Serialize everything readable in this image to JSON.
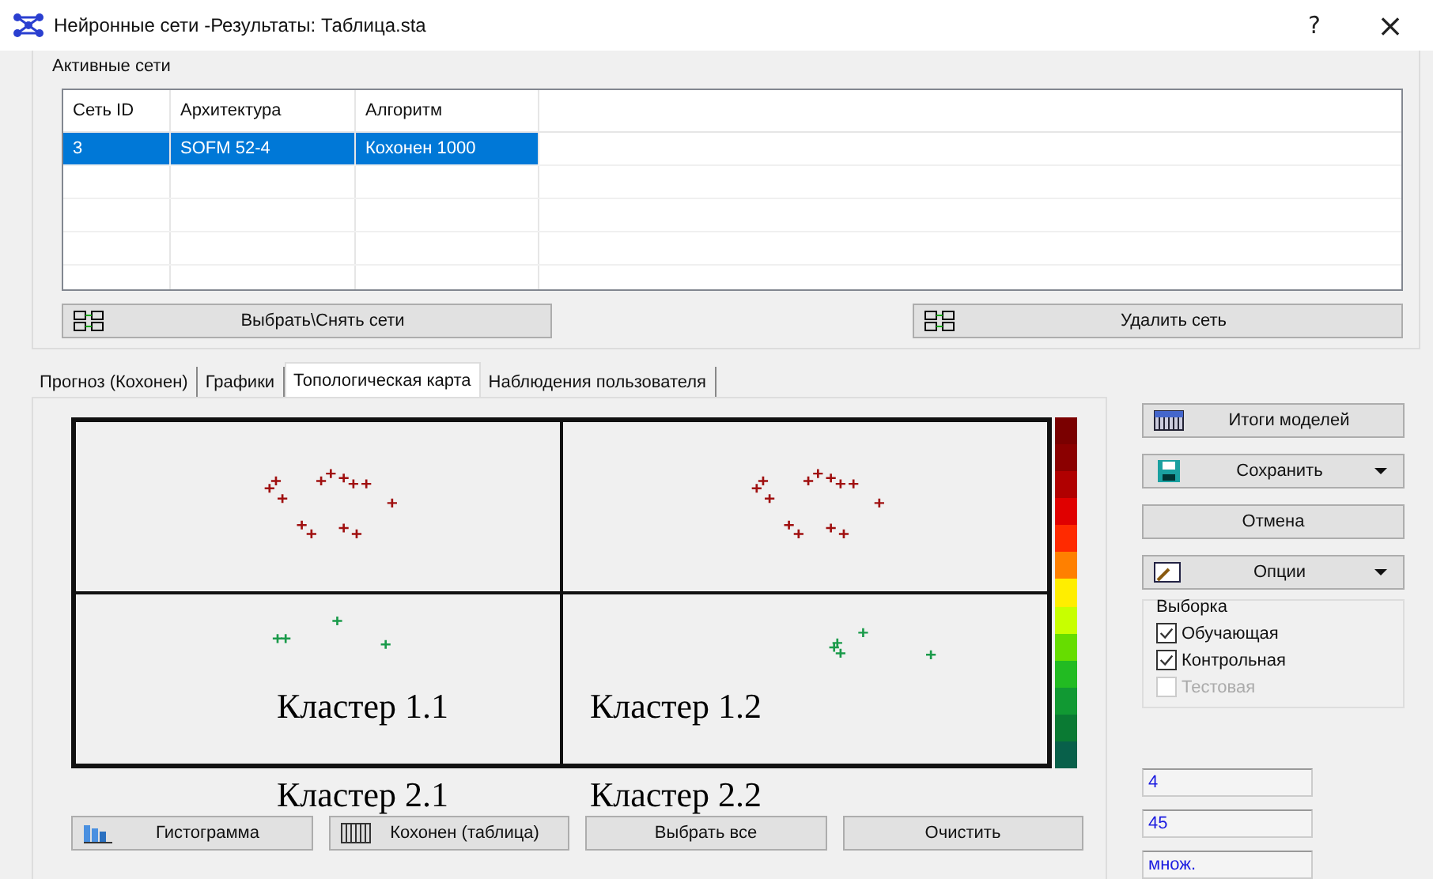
{
  "window": {
    "title": "Нейронные сети -Результаты: Таблица.sta",
    "help": "?",
    "close": "×"
  },
  "active_nets": {
    "title": "Активные сети",
    "columns": [
      "Сеть ID",
      "Архитектура",
      "Алгоритм"
    ],
    "rows": [
      {
        "cells": [
          "3",
          "SOFM 52-4",
          "Кохонен 1000"
        ],
        "selected": true
      }
    ],
    "buttons": [
      {
        "label": "Выбрать\\Снять сети"
      },
      {
        "label": "Удалить сеть"
      }
    ]
  },
  "tabs": [
    {
      "label": "Прогноз (Кохонен)",
      "selected": false
    },
    {
      "label": "Графики",
      "selected": false
    },
    {
      "label": "Топологическая карта",
      "selected": true
    },
    {
      "label": "Наблюдения пользователя",
      "selected": false
    }
  ],
  "map": {
    "labels": [
      "Кластер 1.1",
      "Кластер 1.2",
      "Кластер 2.1",
      "Кластер 2.2"
    ]
  },
  "bottom_buttons": [
    {
      "label": "Гистограмма",
      "kind": "histogram"
    },
    {
      "label": "Кохонен (таблица)",
      "kind": "table"
    },
    {
      "label": "Выбрать все",
      "kind": "plain"
    },
    {
      "label": "Очистить",
      "kind": "plain"
    }
  ],
  "side_buttons": [
    {
      "label": "Итоги моделей",
      "kind": "table",
      "dropdown": false
    },
    {
      "label": "Сохранить",
      "kind": "disk",
      "dropdown": true
    },
    {
      "label": "Отмена",
      "kind": "plain",
      "dropdown": false
    },
    {
      "label": "Опции",
      "kind": "options",
      "dropdown": true
    }
  ],
  "sample": {
    "title": "Выборка",
    "options": [
      {
        "label": "Обучающая",
        "checked": true,
        "disabled": false
      },
      {
        "label": "Контрольная",
        "checked": true,
        "disabled": false
      },
      {
        "label": "Тестовая",
        "checked": false,
        "disabled": true
      }
    ]
  },
  "fields": [
    {
      "value": "4"
    },
    {
      "value": "45"
    },
    {
      "value": "множ."
    }
  ]
}
